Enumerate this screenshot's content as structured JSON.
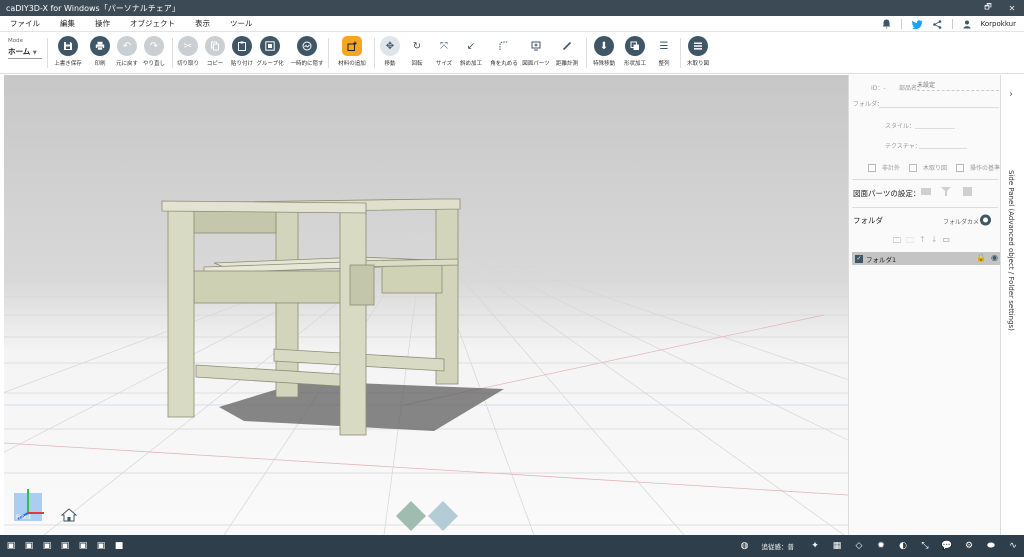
{
  "window": {
    "title": "caDIY3D-X for Windows「パーソナルチェア」",
    "controls": [
      "🗗",
      "✕"
    ]
  },
  "menu": {
    "items": [
      "ファイル",
      "編集",
      "操作",
      "オブジェクト",
      "表示",
      "ツール"
    ],
    "user": "Korpokkur"
  },
  "toolbar": {
    "mode_label": "Mode",
    "mode_value": "ホーム",
    "buttons": [
      {
        "label": "上書き保存",
        "icon": "save-icon"
      },
      {
        "label": "印刷",
        "icon": "print-icon"
      },
      {
        "label": "元に戻す",
        "icon": "undo-icon"
      },
      {
        "label": "やり直し",
        "icon": "redo-icon"
      },
      {
        "label": "切り取り",
        "icon": "cut-icon"
      },
      {
        "label": "コピー",
        "icon": "copy-icon"
      },
      {
        "label": "貼り付け",
        "icon": "paste-icon"
      },
      {
        "label": "グループ化",
        "icon": "group-icon"
      },
      {
        "label": "一時的に隠す",
        "icon": "hide-icon"
      },
      {
        "label": "材料の追加",
        "icon": "add-material-icon"
      },
      {
        "label": "移動",
        "icon": "move-icon"
      },
      {
        "label": "回転",
        "icon": "rotate-icon"
      },
      {
        "label": "サイズ",
        "icon": "resize-icon"
      },
      {
        "label": "斜め加工",
        "icon": "bevel-icon"
      },
      {
        "label": "角を丸める",
        "icon": "round-corner-icon"
      },
      {
        "label": "図面パーツ",
        "icon": "drawing-parts-icon"
      },
      {
        "label": "距離計測",
        "icon": "measure-icon"
      },
      {
        "label": "特殊移動",
        "icon": "special-move-icon"
      },
      {
        "label": "形状加工",
        "icon": "shape-icon"
      },
      {
        "label": "整列",
        "icon": "align-icon"
      },
      {
        "label": "木取り図",
        "icon": "cut-list-icon"
      }
    ]
  },
  "side_panel": {
    "id_label": "ID：-",
    "part_name_label": "部品名：",
    "part_name_placeholder": "未設定",
    "folder_label": "フォルダ：",
    "style_label": "スタイル：",
    "texture_label": "テクスチャ：",
    "checkboxes": [
      "非計外",
      "木取り図",
      "操作の基準"
    ],
    "drawing_parts_setting": "図面パーツの設定：",
    "folder_section": "フォルダ",
    "folder_camera": "フォルダカメラ",
    "folder_item": "フォルダ1",
    "tab_label": "Side Panel (Advanced object / Folder settings)"
  },
  "viewport": {
    "gizmo_label": "Front"
  },
  "statusbar": {
    "snap_label": "追従感：普"
  }
}
